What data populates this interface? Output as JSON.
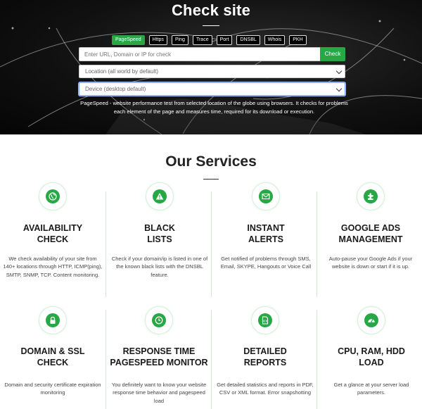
{
  "hero": {
    "title": "Check site",
    "tabs": [
      {
        "label": "PageSpeed",
        "active": true
      },
      {
        "label": "Https",
        "active": false
      },
      {
        "label": "Ping",
        "active": false
      },
      {
        "label": "Trace",
        "active": false
      },
      {
        "label": "Port",
        "active": false
      },
      {
        "label": "DNSBL",
        "active": false
      },
      {
        "label": "Whois",
        "active": false
      },
      {
        "label": "PKH",
        "active": false
      }
    ],
    "url_input": {
      "value": "",
      "placeholder": "Enter URL, Domain or IP for check"
    },
    "check_button": "Check",
    "location_select": "Location (all world by default)",
    "device_select": "Device (desktop default)",
    "description": "PageSpeed - website performance test from selected location of the globe using browsers. It checks for problems each element of the page and measures time, required for its download or execution."
  },
  "services": {
    "title": "Our Services",
    "accent_color": "#28a745",
    "items": [
      {
        "icon": "globe-icon",
        "title": "AVAILABILITY CHECK",
        "title_lines": [
          "AVAILABILITY",
          "CHECK"
        ],
        "description": "We check availability of your site from 140+ locations through HTTP, ICMP(ping), SMTP, SNMP, TCP. Content monitoring."
      },
      {
        "icon": "warning-icon",
        "title": "BLACK LISTS",
        "title_lines": [
          "BLACK",
          "LISTS"
        ],
        "description": "Check if your domain/ip is listed in one of the known black lists with the DNSBL feature."
      },
      {
        "icon": "envelope-icon",
        "title": "INSTANT ALERTS",
        "title_lines": [
          "INSTANT",
          "ALERTS"
        ],
        "description": "Get notified of problems through SMS, Email, SKYPE, Hangouts or Voice Call"
      },
      {
        "icon": "puzzle-icon",
        "title": "GOOGLE ADS MANAGEMENT",
        "title_lines": [
          "GOOGLE ADS",
          "MANAGEMENT"
        ],
        "description": "Auto-pause your Google Ads if your website is down or start if it is up."
      },
      {
        "icon": "lock-icon",
        "title": "DOMAIN & SSL CHECK",
        "title_lines": [
          "DOMAIN & SSL",
          "CHECK"
        ],
        "description": "Domain and security certificate expiration monitoring"
      },
      {
        "icon": "clock-icon",
        "title": "RESPONSE TIME PAGESPEED MONITOR",
        "title_lines": [
          "RESPONSE TIME",
          "PAGESPEED MONITOR"
        ],
        "description": "You definitely want to know your website response time behavior and pagespeed load"
      },
      {
        "icon": "code-file-icon",
        "title": "DETAILED REPORTS",
        "title_lines": [
          "DETAILED",
          "REPORTS"
        ],
        "description": "Get detailed statistics and reports in PDF, CSV or XML format. Error snapshotting"
      },
      {
        "icon": "gauge-icon",
        "title": "CPU, RAM, HDD LOAD",
        "title_lines": [
          "CPU, RAM, HDD",
          "LOAD"
        ],
        "description": "Get a glance at your server load parameters."
      }
    ]
  }
}
